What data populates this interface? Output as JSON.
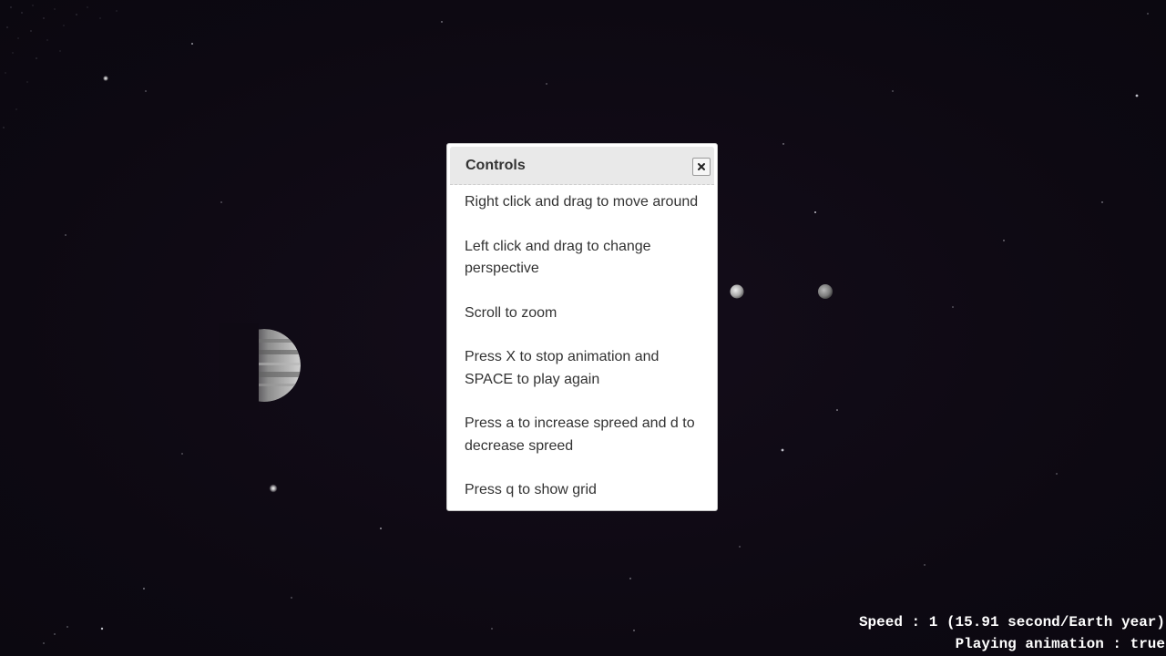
{
  "dialog": {
    "title": "Controls",
    "close_icon": "close-icon",
    "instructions": [
      "Right click and drag to move around",
      "Left click and drag to change perspective",
      "Scroll to zoom",
      "Press X to stop animation and SPACE to play again",
      "Press a to increase spreed and d to decrease spreed",
      "Press q to show grid"
    ]
  },
  "status": {
    "speed": "Speed : 1 (15.91 second/Earth year)",
    "animation": "Playing animation : true"
  },
  "colors": {
    "background": "#0f0a14",
    "dialog_header": "#e9e9e9",
    "text": "#333333",
    "status_text": "#ffffff"
  }
}
